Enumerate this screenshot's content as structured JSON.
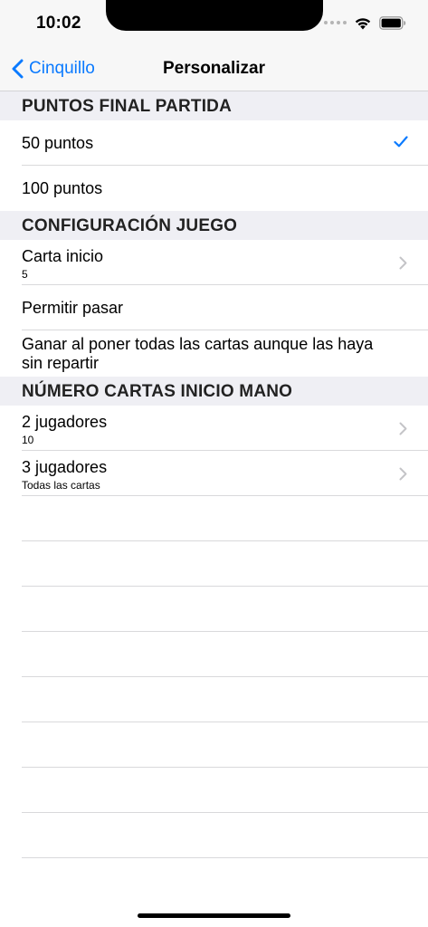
{
  "status_bar": {
    "time": "10:02"
  },
  "nav": {
    "back_label": "Cinquillo",
    "title": "Personalizar"
  },
  "sections": {
    "points": {
      "header": "PUNTOS FINAL PARTIDA",
      "options": [
        {
          "label": "50 puntos",
          "selected": true
        },
        {
          "label": "100 puntos",
          "selected": false
        }
      ]
    },
    "config": {
      "header": "CONFIGURACIÓN JUEGO",
      "start_card": {
        "title": "Carta inicio",
        "value": "5"
      },
      "allow_pass": {
        "title": "Permitir pasar"
      },
      "win_rule": {
        "title": "Ganar al poner todas las cartas aunque las haya sin repartir"
      }
    },
    "hand": {
      "header": "NÚMERO CARTAS INICIO MANO",
      "two_players": {
        "title": "2 jugadores",
        "value": "10"
      },
      "three_players": {
        "title": "3 jugadores",
        "value": "Todas las cartas"
      }
    }
  },
  "colors": {
    "accent": "#0a7aff",
    "section_bg": "#efeff4",
    "bar_bg": "#f7f7f7"
  },
  "icons": [
    "back-chevron-icon",
    "checkmark-icon",
    "disclosure-chevron-icon",
    "wifi-icon",
    "battery-icon",
    "signal-icon"
  ]
}
